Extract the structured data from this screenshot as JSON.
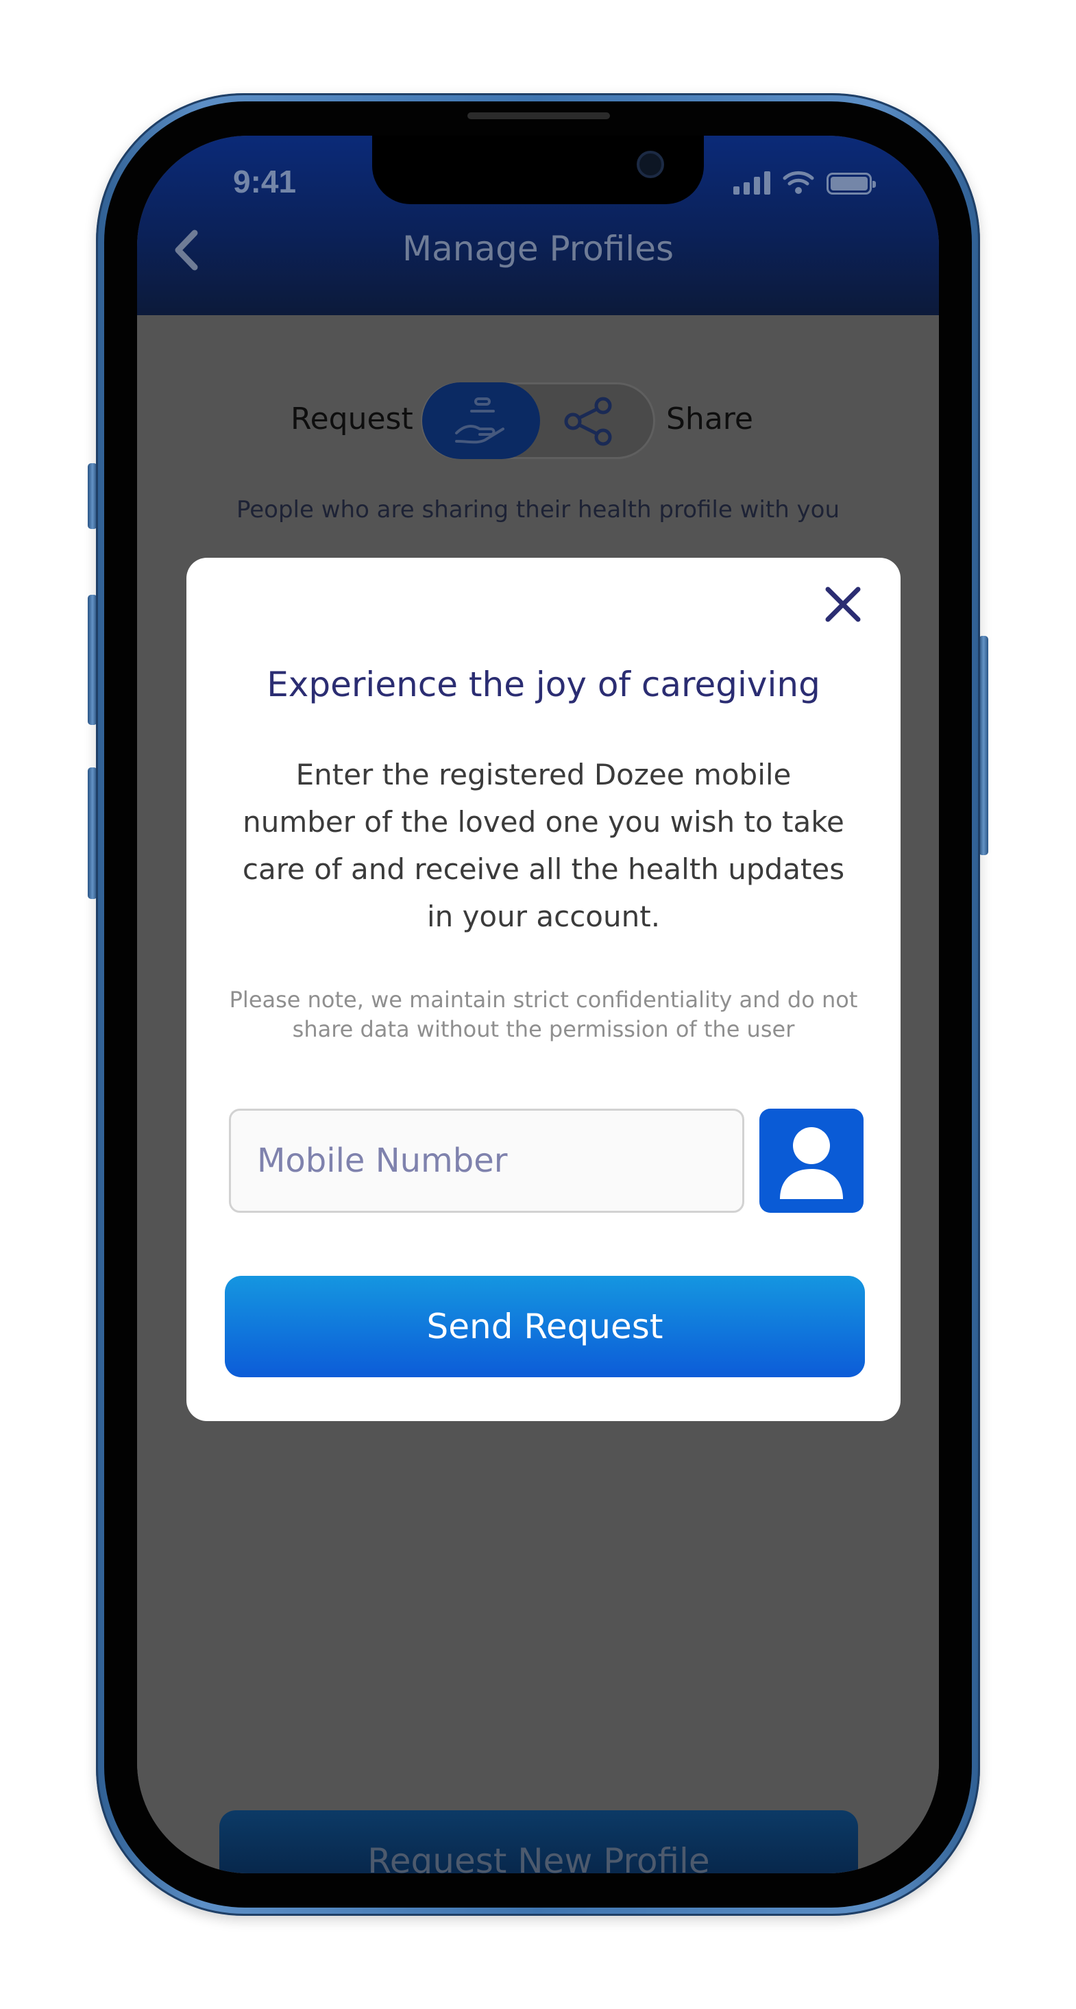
{
  "status_bar": {
    "time": "9:41"
  },
  "header": {
    "title": "Manage Profiles"
  },
  "toggle": {
    "left_label": "Request",
    "right_label": "Share",
    "selected": "Request"
  },
  "page": {
    "subtitle": "People who are sharing their health profile with you",
    "bottom_button_label": "Request New Profile"
  },
  "modal": {
    "title": "Experience the joy of caregiving",
    "body": "Enter the registered Dozee mobile number of the loved one you wish to take care of and receive all the health updates in your account.",
    "note": "Please note, we maintain strict confidentiality and do not share data without the permission of the user",
    "input": {
      "placeholder": "Mobile Number",
      "value": ""
    },
    "send_button_label": "Send Request"
  },
  "icons": {
    "back": "chevron-left-icon",
    "request_toggle": "hand-giving-icon",
    "share_toggle": "share-icon",
    "close": "close-icon",
    "contact": "person-icon"
  },
  "colors": {
    "header": "#0b2158",
    "modal_title": "#2b2d72",
    "primary_button": "#0c5cd8",
    "contact_button": "#0a5bd6",
    "overlay": "#545454"
  }
}
